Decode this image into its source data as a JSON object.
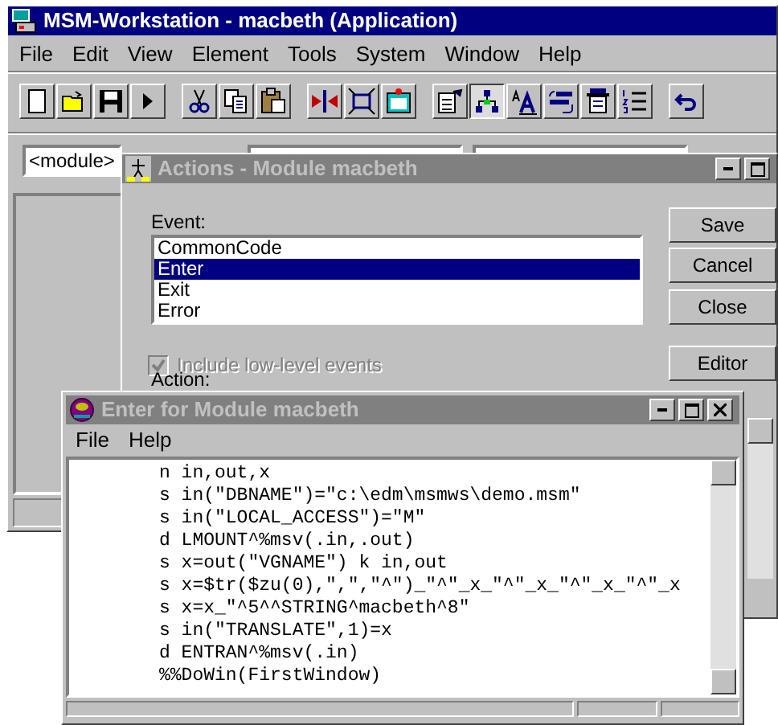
{
  "main_window": {
    "title": "MSM-Workstation - macbeth (Application)",
    "active": true,
    "menu": [
      "File",
      "Edit",
      "View",
      "Element",
      "Tools",
      "System",
      "Window",
      "Help"
    ],
    "toolbar": [
      [
        {
          "kind": "new",
          "pressed": false
        },
        {
          "kind": "open",
          "pressed": false
        },
        {
          "kind": "save",
          "pressed": false
        },
        {
          "kind": "run",
          "pressed": false
        }
      ],
      [
        {
          "kind": "cut",
          "pressed": false
        },
        {
          "kind": "copy",
          "pressed": false
        },
        {
          "kind": "paste",
          "pressed": false
        }
      ],
      [
        {
          "kind": "split",
          "pressed": false
        },
        {
          "kind": "resize",
          "pressed": false
        },
        {
          "kind": "window",
          "pressed": false
        }
      ],
      [
        {
          "kind": "properties",
          "pressed": false
        },
        {
          "kind": "hierarchy",
          "pressed": true
        },
        {
          "kind": "font",
          "pressed": false
        },
        {
          "kind": "exchange",
          "pressed": false
        },
        {
          "kind": "report",
          "pressed": false
        },
        {
          "kind": "numbered",
          "pressed": false
        }
      ],
      [
        {
          "kind": "undo",
          "pressed": false
        }
      ]
    ],
    "combo": {
      "value": "<module>"
    }
  },
  "actions_dialog": {
    "title": "Actions - Module macbeth",
    "active": false,
    "event_label": "Event:",
    "events": [
      {
        "label": "CommonCode",
        "selected": false
      },
      {
        "label": "Enter",
        "selected": true
      },
      {
        "label": "Exit",
        "selected": false
      },
      {
        "label": "Error",
        "selected": false
      }
    ],
    "checkbox": {
      "label": "Include low-level events",
      "checked": true,
      "disabled": true
    },
    "action_label": "Action:",
    "buttons": [
      "Save",
      "Cancel",
      "Close",
      "Editor"
    ]
  },
  "editor_window": {
    "title": "Enter for Module macbeth",
    "active": false,
    "menu": [
      "File",
      "Help"
    ],
    "code": [
      "n in,out,x",
      "s in(\"DBNAME\")=\"c:\\edm\\msmws\\demo.msm\"",
      "s in(\"LOCAL_ACCESS\")=\"M\"",
      "d LMOUNT^%msv(.in,.out)",
      "s x=out(\"VGNAME\") k in,out",
      "s x=$tr($zu(0),\",\",\"^\")_\"^\"_x_\"^\"_x_\"^\"_x_\"^\"_x",
      "s x=x_\"^5^^STRING^macbeth^8\"",
      "s in(\"TRANSLATE\",1)=x",
      "d ENTRAN^%msv(.in)",
      "%%DoWin(FirstWindow)"
    ]
  }
}
